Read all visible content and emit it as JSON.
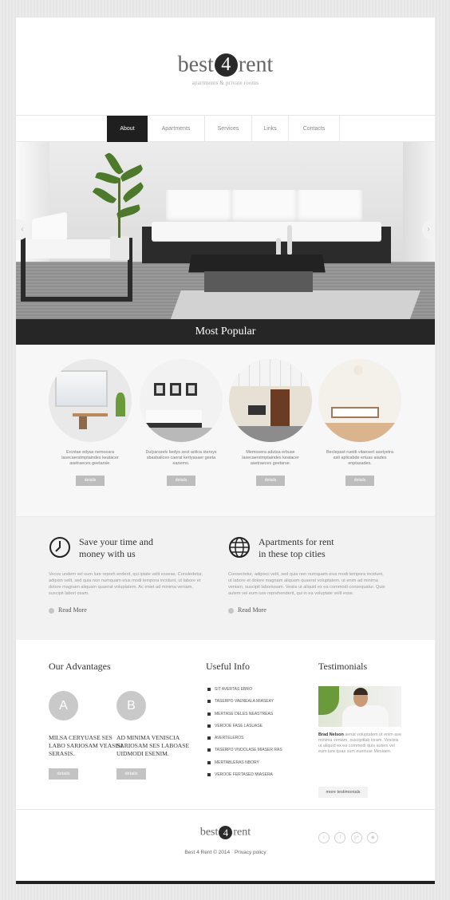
{
  "header": {
    "logo_pre": "best",
    "logo_num": "4",
    "logo_post": "rent",
    "tagline": "apartments & private rooms"
  },
  "nav": {
    "items": [
      {
        "label": "About",
        "active": true
      },
      {
        "label": "Apartments"
      },
      {
        "label": "Services"
      },
      {
        "label": "Links"
      },
      {
        "label": "Contacts"
      }
    ]
  },
  "hero": {
    "caption": "Most Popular",
    "prev_arrow": "‹",
    "next_arrow": "›"
  },
  "popular": {
    "cards": [
      {
        "text": "Ercntae edyas nemoosra lasecaerstmptaindes keatacer asetraeces geetarsie.",
        "button": "details"
      },
      {
        "text": "Dulyarsselv kedys sest aolica stersys sbasbalices caerat kertyasaer geeta eanemo.",
        "button": "details"
      },
      {
        "text": "Memosera adutsa erbuse lasecaerstmptaindes keatacer asetraeces geetarse.",
        "button": "details"
      },
      {
        "text": "Beclepast rueidi vitaesert asetyetra asti aplicabde ertuas aiades enptasades.",
        "button": "details"
      }
    ]
  },
  "features": [
    {
      "title_line1": "Save your time and",
      "title_line2": "money with us",
      "text": "Vecos undem vel oum lure repreh enderit, qui ipiate velit esseas. Consledetur, adipisn velit, sed quia non numquam eius modi tempora incidunt, ut labore et dolore magnam aliquam quaerat voluptatem. Ac eniet ad minima veniam, suscipit labori osam.",
      "more": "Read More"
    },
    {
      "title_line1": "Apartments for rent",
      "title_line2": "in these top cities",
      "text": "Consectetur, adipisci velit, sed quia non numquam eius modi tempora incidunt, ut labore et dolore magnam aliquam quaerat voluptatem. ut enim ad minima veniam, suscipit laboriosam. Vesiis ut aliquid ex ea commodi consequatur. Quis autem vel eum iure reprehenderit, qui in ea voluptate velit esse.",
      "more": "Read More"
    }
  ],
  "advantages": {
    "title": "Our Advantages",
    "items": [
      {
        "letter": "A",
        "text": "MILSA CERYUASE SES LABO SARIOSAM VEASISI SERASIS.",
        "button": "details"
      },
      {
        "letter": "B",
        "text": "AD MINIMA VENISCIA SARIOSAM SES LABOASE UIDMODI ESENIM.",
        "button": "details"
      }
    ]
  },
  "useful_info": {
    "title": "Useful Info",
    "links": [
      "SIT AVERTAS EBRO",
      "TASERPO VAENEALA MIASEAY",
      "MERTASE DELES NEASTREAS",
      "VEROOE FASE LASUASE",
      "AVERTELEROS",
      "TASERPO VNOOLASE MIASER RAS",
      "MERTABLERAS NBORY",
      "VEROOE FERTASED MIASERA"
    ]
  },
  "testimonials": {
    "title": "Testimonials",
    "author": "Brad Nelson",
    "quote": "aenat voluptatem ut enim ase minima veniam, suscipitlab ioram. Vesiisis ut aliquid ex ea commodi quis autem vel eum iure quas sum eueriuse Mesiaen.",
    "button": "more testimonials"
  },
  "footer": {
    "logo_pre": "best",
    "logo_num": "4",
    "logo_post": "rent",
    "copyright": "Best 4 Rent © 2014",
    "separator": "·",
    "privacy": "Privacy policy",
    "socials": [
      {
        "icon": "twitter-icon",
        "glyph": "t"
      },
      {
        "icon": "facebook-icon",
        "glyph": "f"
      },
      {
        "icon": "google-plus-icon",
        "glyph": "g+"
      },
      {
        "icon": "rss-icon",
        "glyph": "◉"
      }
    ]
  }
}
